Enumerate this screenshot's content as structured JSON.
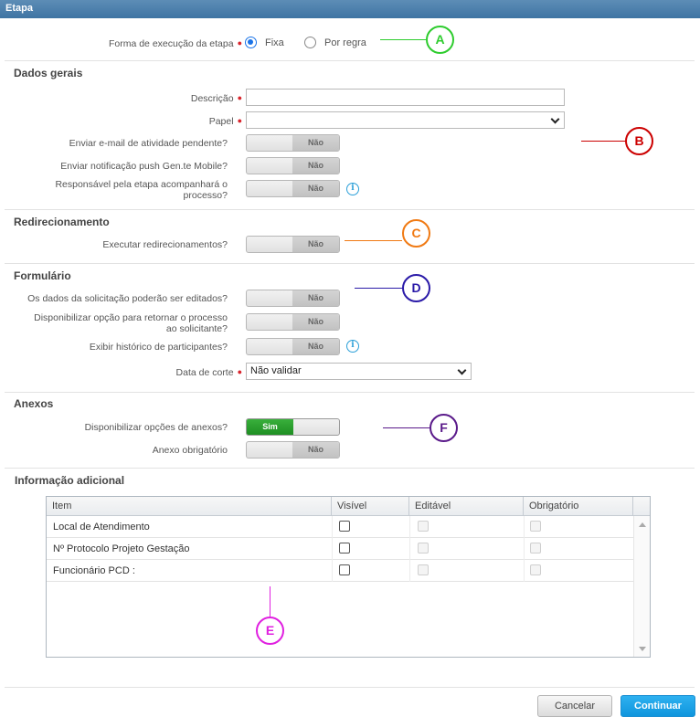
{
  "window": {
    "title": "Etapa"
  },
  "execution": {
    "label": "Forma de execução da etapa",
    "options": [
      "Fixa",
      "Por regra"
    ],
    "selected": "Fixa"
  },
  "sections": {
    "general": "Dados gerais",
    "redirect": "Redirecionamento",
    "form": "Formulário",
    "attachments": "Anexos",
    "additional": "Informação adicional"
  },
  "general": {
    "description_label": "Descrição",
    "description_value": "",
    "role_label": "Papel",
    "role_value": "",
    "email_label": "Enviar e-mail de atividade pendente?",
    "email_value": "Não",
    "push_label": "Enviar notificação push Gen.te Mobile?",
    "push_value": "Não",
    "responsible_label_1": "Responsável pela etapa acompanhará o",
    "responsible_label_2": "processo?",
    "responsible_value": "Não"
  },
  "redirect": {
    "execute_label": "Executar redirecionamentos?",
    "execute_value": "Não"
  },
  "form": {
    "editable_label": "Os dados da solicitação poderão ser editados?",
    "editable_value": "Não",
    "return_label_1": "Disponibilizar opção para retornar o processo",
    "return_label_2": "ao solicitante?",
    "return_value": "Não",
    "history_label": "Exibir histórico de participantes?",
    "history_value": "Não",
    "cutoff_label": "Data de corte",
    "cutoff_value": "Não validar"
  },
  "attachments": {
    "options_label": "Disponibilizar opções de anexos?",
    "options_value": "Sim",
    "required_label": "Anexo obrigatório",
    "required_value": "Não"
  },
  "table": {
    "columns": [
      "Item",
      "Visível",
      "Editável",
      "Obrigatório"
    ],
    "rows": [
      {
        "item": "Local de Atendimento"
      },
      {
        "item": "Nº Protocolo Projeto Gestação"
      },
      {
        "item": "Funcionário PCD :"
      }
    ]
  },
  "callouts": {
    "a": {
      "letter": "A",
      "color": "#2ecc2e"
    },
    "b": {
      "letter": "B",
      "color": "#cc0000"
    },
    "c": {
      "letter": "C",
      "color": "#f07a14"
    },
    "d": {
      "letter": "D",
      "color": "#2a1aa8"
    },
    "e": {
      "letter": "E",
      "color": "#e020e0"
    },
    "f": {
      "letter": "F",
      "color": "#5a1a8a"
    }
  },
  "footer": {
    "cancel": "Cancelar",
    "continue": "Continuar"
  },
  "colors": {
    "titlebar": "#3f74a3",
    "required": "#d9242c",
    "toggle_on": "#1e8e22",
    "primary": "#0f95dd",
    "info": "#2a9fd8"
  }
}
